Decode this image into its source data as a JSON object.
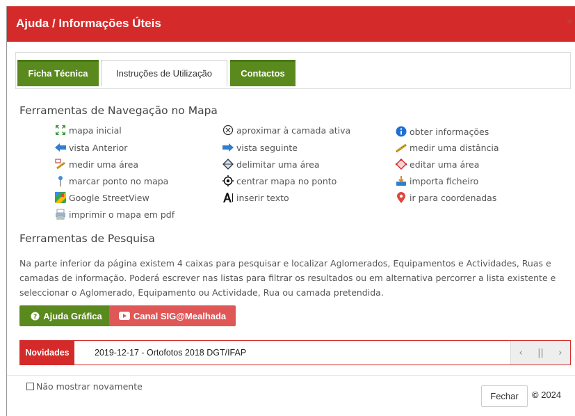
{
  "header": {
    "title": "Ajuda / Informações Úteis",
    "close": "×"
  },
  "tabs": [
    {
      "label": "Ficha Técnica"
    },
    {
      "label": "Instruções de Utilização"
    },
    {
      "label": "Contactos"
    }
  ],
  "navigation": {
    "title": "Ferramentas de Navegação no Mapa",
    "tools": [
      {
        "label": "mapa inicial",
        "icon": "full-extent-icon"
      },
      {
        "label": "aproximar à camada ativa",
        "icon": "zoom-layer-icon"
      },
      {
        "label": "obter informações",
        "icon": "info-icon"
      },
      {
        "label": "vista Anterior",
        "icon": "arrow-left-icon"
      },
      {
        "label": "vista seguinte",
        "icon": "arrow-right-icon"
      },
      {
        "label": "medir uma distância",
        "icon": "ruler-icon"
      },
      {
        "label": "medir uma área",
        "icon": "measure-area-icon"
      },
      {
        "label": "delimitar uma área",
        "icon": "draw-polygon-icon"
      },
      {
        "label": "editar uma área",
        "icon": "edit-polygon-icon"
      },
      {
        "label": "marcar ponto no mapa",
        "icon": "pin-icon"
      },
      {
        "label": "centrar mapa no ponto",
        "icon": "target-icon"
      },
      {
        "label": "importa ficheiro",
        "icon": "import-icon"
      },
      {
        "label": "Google StreetView",
        "icon": "streetview-icon"
      },
      {
        "label": "inserir texto",
        "icon": "text-icon"
      },
      {
        "label": "ir para coordenadas",
        "icon": "location-marker-icon"
      },
      {
        "label": "imprimir o mapa em pdf",
        "icon": "print-icon"
      }
    ]
  },
  "search": {
    "title": "Ferramentas de Pesquisa",
    "text": "Na parte inferior da página existem 4 caixas para pesquisar e localizar Aglomerados, Equipamentos e Actividades, Ruas e camadas de informação. Poderá escrever nas listas para filtrar os resultados ou em alternativa percorrer a lista existente e seleccionar o Aglomerado, Equipamento ou Actividade, Rua ou camada pretendida."
  },
  "buttons": {
    "help": "Ajuda Gráfica",
    "channel": "Canal SIG@Mealhada"
  },
  "news": {
    "label": "Novidades",
    "text": "2019-12-17 - Ortofotos 2018 DGT/IFAP",
    "prev": "‹",
    "pause": "||",
    "next": "›"
  },
  "footer": {
    "dont_show": "Não mostrar novamente",
    "close": "Fechar",
    "copyright_symbol": "©",
    "year": "2024"
  },
  "colors": {
    "header": "#d42a2a",
    "green": "#5a8a1e",
    "red_button": "#e05757"
  }
}
